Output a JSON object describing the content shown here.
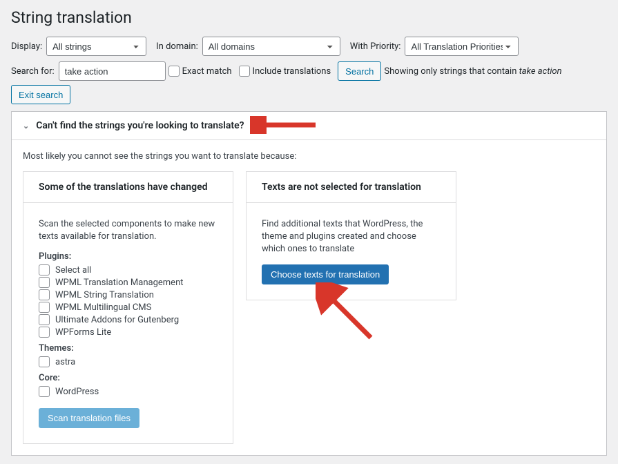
{
  "page_title": "String translation",
  "filters": {
    "display_label": "Display:",
    "display_value": "All strings",
    "domain_label": "In domain:",
    "domain_value": "All domains",
    "priority_label": "With Priority:",
    "priority_value": "All Translation Priorities"
  },
  "search": {
    "label": "Search for:",
    "value": "take action",
    "exact_match_label": "Exact match",
    "include_translations_label": "Include translations",
    "search_button": "Search",
    "showing_text": "Showing only strings that contain ",
    "showing_term": "take action",
    "exit_button": "Exit search"
  },
  "accordion": {
    "title": "Can't find the strings you're looking to translate?",
    "lead": "Most likely you cannot see the strings you want to translate because:"
  },
  "card1": {
    "title": "Some of the translations have changed",
    "desc": "Scan the selected components to make new texts available for translation.",
    "plugins_label": "Plugins:",
    "plugins": [
      "Select all",
      "WPML Translation Management",
      "WPML String Translation",
      "WPML Multilingual CMS",
      "Ultimate Addons for Gutenberg",
      "WPForms Lite"
    ],
    "themes_label": "Themes:",
    "themes": [
      "astra"
    ],
    "core_label": "Core:",
    "core": [
      "WordPress"
    ],
    "scan_button": "Scan translation files"
  },
  "card2": {
    "title": "Texts are not selected for translation",
    "desc": "Find additional texts that WordPress, the theme and plugins created and choose which ones to translate",
    "choose_button": "Choose texts for translation"
  }
}
